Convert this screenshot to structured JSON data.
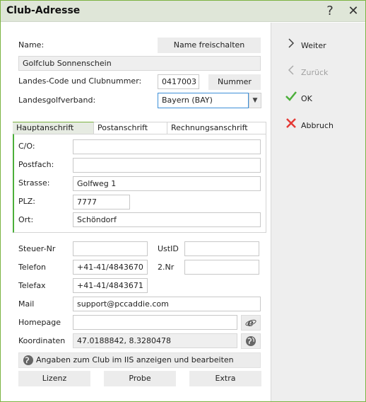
{
  "window": {
    "title": "Club-Adresse",
    "help_glyph": "?",
    "close_glyph": "✕"
  },
  "club": {
    "name_label": "Name:",
    "unlock_button": "Name freischalten",
    "name_value": "Golfclub Sonnenschein",
    "code_label": "Landes-Code und Clubnummer:",
    "code_value": "0417003",
    "number_button": "Nummer",
    "federation_label": "Landesgolfverband:",
    "federation_value": "Bayern (BAY)"
  },
  "tabs": [
    {
      "label": "Hauptanschrift",
      "active": true
    },
    {
      "label": "Postanschrift",
      "active": false
    },
    {
      "label": "Rechnungsanschrift",
      "active": false
    }
  ],
  "address": {
    "co_label": "C/O:",
    "co_value": "",
    "postbox_label": "Postfach:",
    "postbox_value": "",
    "street_label": "Strasse:",
    "street_value": "Golfweg 1",
    "zip_label": "PLZ:",
    "zip_value": "7777",
    "city_label": "Ort:",
    "city_value": "Schöndorf"
  },
  "contact": {
    "tax_label": "Steuer-Nr",
    "tax_value": "",
    "vat_label": "UstID",
    "vat_value": "",
    "phone_label": "Telefon",
    "phone_value": "+41-41/4843670",
    "phone2_label": "2.Nr",
    "phone2_value": "",
    "fax_label": "Telefax",
    "fax_value": "+41-41/4843671",
    "mail_label": "Mail",
    "mail_value": "support@pccaddie.com",
    "homepage_label": "Homepage",
    "homepage_value": "",
    "coords_label": "Koordinaten",
    "coords_value": "47.0188842, 8.3280478"
  },
  "iis_button": "Angaben zum Club im IIS anzeigen und bearbeiten",
  "bottom_buttons": {
    "license": "Lizenz",
    "sample": "Probe",
    "extra": "Extra"
  },
  "actions": {
    "next": "Weiter",
    "back": "Zurück",
    "ok": "OK",
    "cancel": "Abbruch"
  },
  "colors": {
    "accent_green": "#4caf3a",
    "cancel_red": "#e53935",
    "select_border": "#3d8fd8"
  }
}
